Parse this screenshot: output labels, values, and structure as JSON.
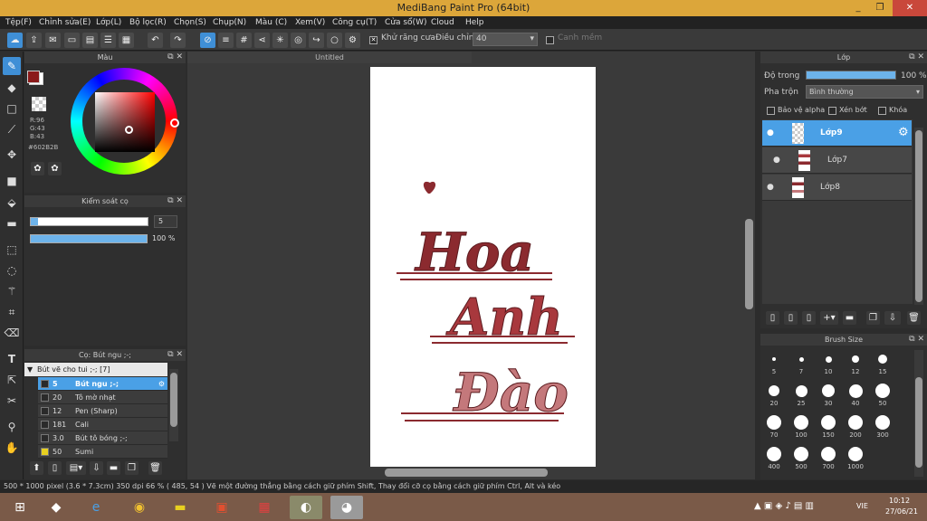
{
  "window": {
    "title": "MediBang Paint Pro (64bit)",
    "minimize": "_",
    "maximize": "❐",
    "close": "✕"
  },
  "menu": [
    "Tệp(F)",
    "Chỉnh sửa(E)",
    "Lớp(L)",
    "Bộ lọc(R)",
    "Chọn(S)",
    "Chụp(N)",
    "Màu (C)",
    "Xem(V)",
    "Công cụ(T)",
    "Cửa sổ(W)",
    "Cloud",
    "Help"
  ],
  "toolbar": {
    "antialias_label": "Khử răng cưa",
    "adjust_label": "Điều chỉnh",
    "adjust_value": "40",
    "smooth_label": "Canh mềm"
  },
  "color_panel": {
    "title": "Màu",
    "r": "R:96",
    "g": "G:43",
    "b": "B:43",
    "hex": "#602B2B",
    "primary": "#8b1a1a"
  },
  "brush_control": {
    "title": "Kiểm soát cọ",
    "size": "5",
    "opacity": "100 %",
    "size_fraction": 0.06,
    "opacity_fraction": 1.0
  },
  "brush_panel": {
    "title": "Cọ: Bút ngu ;-;",
    "group": "Bút vẽ cho tui ;-; [7]",
    "items": [
      {
        "size": "5",
        "name": "Bút ngu ;-;",
        "color": "#2a2a2a"
      },
      {
        "size": "20",
        "name": "Tô mờ nhạt",
        "color": "#2a2a2a"
      },
      {
        "size": "12",
        "name": "Pen (Sharp)",
        "color": "#2a2a2a"
      },
      {
        "size": "181",
        "name": "Cali",
        "color": "#2a2a2a"
      },
      {
        "size": "3.0",
        "name": "Bút tô bóng ;-;",
        "color": "#2a2a2a"
      },
      {
        "size": "50",
        "name": "Sumi",
        "color": "#e8d020"
      }
    ]
  },
  "canvas": {
    "doc_tab": "Untitled",
    "line1": "Hoa",
    "line2": "Anh",
    "line3": "Đào"
  },
  "layer_panel": {
    "title": "Lớp",
    "opacity_label": "Độ trong",
    "opacity_value": "100 %",
    "opacity_fraction": 1.0,
    "blend_label": "Pha trộn",
    "blend_value": "Bình thường",
    "protect_alpha": "Bảo vệ alpha",
    "clipping": "Xén bớt",
    "lock": "Khóa",
    "layers": [
      {
        "name": "Lớp9"
      },
      {
        "name": "Lớp7"
      },
      {
        "name": "Lớp8"
      }
    ]
  },
  "brush_size": {
    "title": "Brush Size",
    "sizes": [
      "5",
      "7",
      "10",
      "12",
      "15",
      "20",
      "25",
      "30",
      "40",
      "50",
      "70",
      "100",
      "150",
      "200",
      "300",
      "400",
      "500",
      "700",
      "1000"
    ]
  },
  "status": {
    "text": "500 * 1000 pixel   (3.6 * 7.3cm)   350 dpi   66 %   ( 485, 54 )   Vẽ một đường thẳng bằng cách giữ phím Shift, Thay đổi cỡ cọ bằng cách giữ phím Ctrl, Alt và kéo"
  },
  "tray": {
    "lang": "VIE",
    "time": "10:12",
    "date": "27/06/21"
  }
}
